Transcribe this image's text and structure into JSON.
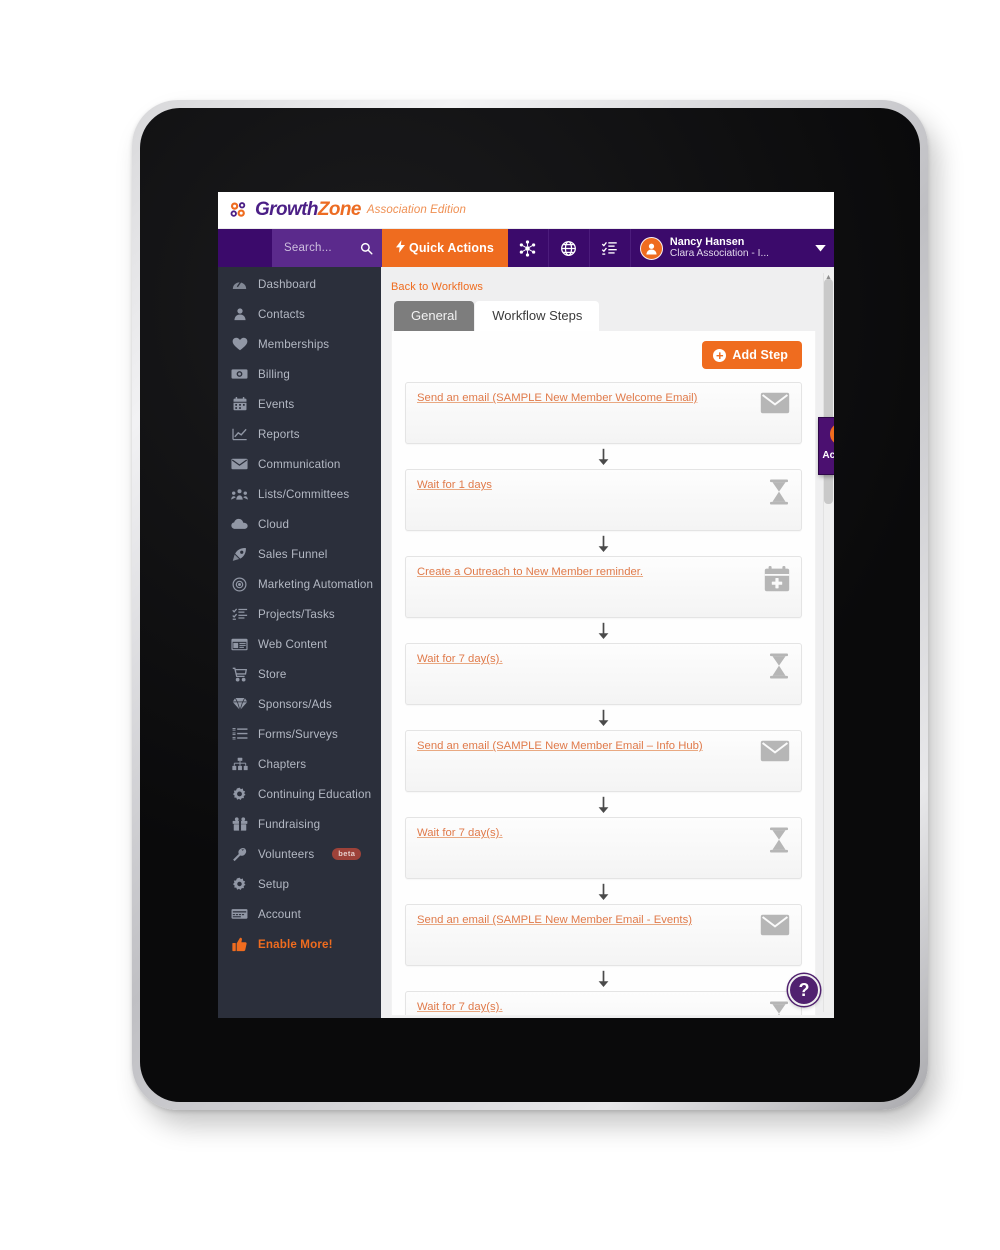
{
  "app": {
    "logo_growth": "Growth",
    "logo_zone": "Zone",
    "edition": "Association Edition",
    "logo_icon": "gears-logo-icon"
  },
  "topnav": {
    "search_placeholder": "Search...",
    "search_icon": "search-icon",
    "quick_actions_label": "Quick Actions",
    "quick_actions_icon": "lightning-bolt-icon",
    "icons": [
      {
        "name": "hub-network-icon"
      },
      {
        "name": "globe-icon"
      },
      {
        "name": "checklist-icon"
      }
    ],
    "user": {
      "name": "Nancy Hansen",
      "org": "Clara Association - I...",
      "avatar_icon": "user-avatar-icon",
      "caret_icon": "chevron-down-icon"
    }
  },
  "sidebar": {
    "items": [
      {
        "label": "Dashboard",
        "icon": "dashboard-icon",
        "badge": null,
        "highlight": false
      },
      {
        "label": "Contacts",
        "icon": "contacts-icon",
        "badge": null,
        "highlight": false
      },
      {
        "label": "Memberships",
        "icon": "heart-icon",
        "badge": null,
        "highlight": false
      },
      {
        "label": "Billing",
        "icon": "money-icon",
        "badge": null,
        "highlight": false
      },
      {
        "label": "Events",
        "icon": "calendar-icon",
        "badge": null,
        "highlight": false
      },
      {
        "label": "Reports",
        "icon": "chart-icon",
        "badge": null,
        "highlight": false
      },
      {
        "label": "Communication",
        "icon": "envelope-icon",
        "badge": null,
        "highlight": false
      },
      {
        "label": "Lists/Committees",
        "icon": "people-group-icon",
        "badge": null,
        "highlight": false
      },
      {
        "label": "Cloud",
        "icon": "cloud-icon",
        "badge": null,
        "highlight": false
      },
      {
        "label": "Sales Funnel",
        "icon": "funnel-icon",
        "badge": null,
        "highlight": false
      },
      {
        "label": "Marketing Automation",
        "icon": "target-icon",
        "badge": null,
        "highlight": false
      },
      {
        "label": "Projects/Tasks",
        "icon": "tasks-icon",
        "badge": null,
        "highlight": false
      },
      {
        "label": "Web Content",
        "icon": "browser-icon",
        "badge": null,
        "highlight": false
      },
      {
        "label": "Store",
        "icon": "cart-icon",
        "badge": null,
        "highlight": false
      },
      {
        "label": "Sponsors/Ads",
        "icon": "diamond-icon",
        "badge": null,
        "highlight": false
      },
      {
        "label": "Forms/Surveys",
        "icon": "list-icon",
        "badge": null,
        "highlight": false
      },
      {
        "label": "Chapters",
        "icon": "sitemap-icon",
        "badge": null,
        "highlight": false
      },
      {
        "label": "Continuing Education",
        "icon": "gear-badge-icon",
        "badge": null,
        "highlight": false
      },
      {
        "label": "Fundraising",
        "icon": "gift-icon",
        "badge": null,
        "highlight": false
      },
      {
        "label": "Volunteers",
        "icon": "wrench-icon",
        "badge": "beta",
        "highlight": false
      },
      {
        "label": "Setup",
        "icon": "gear-icon",
        "badge": null,
        "highlight": false
      },
      {
        "label": "Account",
        "icon": "card-icon",
        "badge": null,
        "highlight": false
      },
      {
        "label": "Enable More!",
        "icon": "thumbs-up-icon",
        "badge": null,
        "highlight": true
      }
    ]
  },
  "content": {
    "back_link": "Back to Workflows",
    "tabs": [
      {
        "label": "General",
        "active": true
      },
      {
        "label": "Workflow Steps",
        "active": false
      }
    ],
    "add_step_label": "Add Step",
    "add_step_icon": "plus-circle-icon",
    "steps": [
      {
        "label": "Send an email (SAMPLE New Member Welcome Email)",
        "icon": "envelope-icon"
      },
      {
        "label": "Wait for 1 days",
        "icon": "hourglass-icon"
      },
      {
        "label": "Create a Outreach to New Member reminder.",
        "icon": "calendar-plus-icon"
      },
      {
        "label": "Wait for 7 day(s).",
        "icon": "hourglass-icon"
      },
      {
        "label": "Send an email (SAMPLE New Member Email – Info Hub)",
        "icon": "envelope-icon"
      },
      {
        "label": "Wait for 7 day(s).",
        "icon": "hourglass-icon"
      },
      {
        "label": "Send an email (SAMPLE New Member Email - Events)",
        "icon": "envelope-icon"
      },
      {
        "label": "Wait for 7 day(s).",
        "icon": "hourglass-icon"
      }
    ],
    "arrow_icon": "arrow-down-icon"
  },
  "actions_tab": {
    "label": "Actions",
    "bolt_icon": "lightning-bolt-icon",
    "caret_icon": "chevron-down-icon"
  },
  "help": {
    "label": "?",
    "icon": "question-mark-icon"
  },
  "colors": {
    "nav_purple": "#3b0a6b",
    "search_purple": "#5b2a8c",
    "accent_orange": "#ef6c1f",
    "sidebar_dark": "#2b2f3b",
    "link_orange": "#e07a4a",
    "actions_purple": "#4b1070",
    "help_purple": "#50216f",
    "beta_red": "#9d4239"
  }
}
